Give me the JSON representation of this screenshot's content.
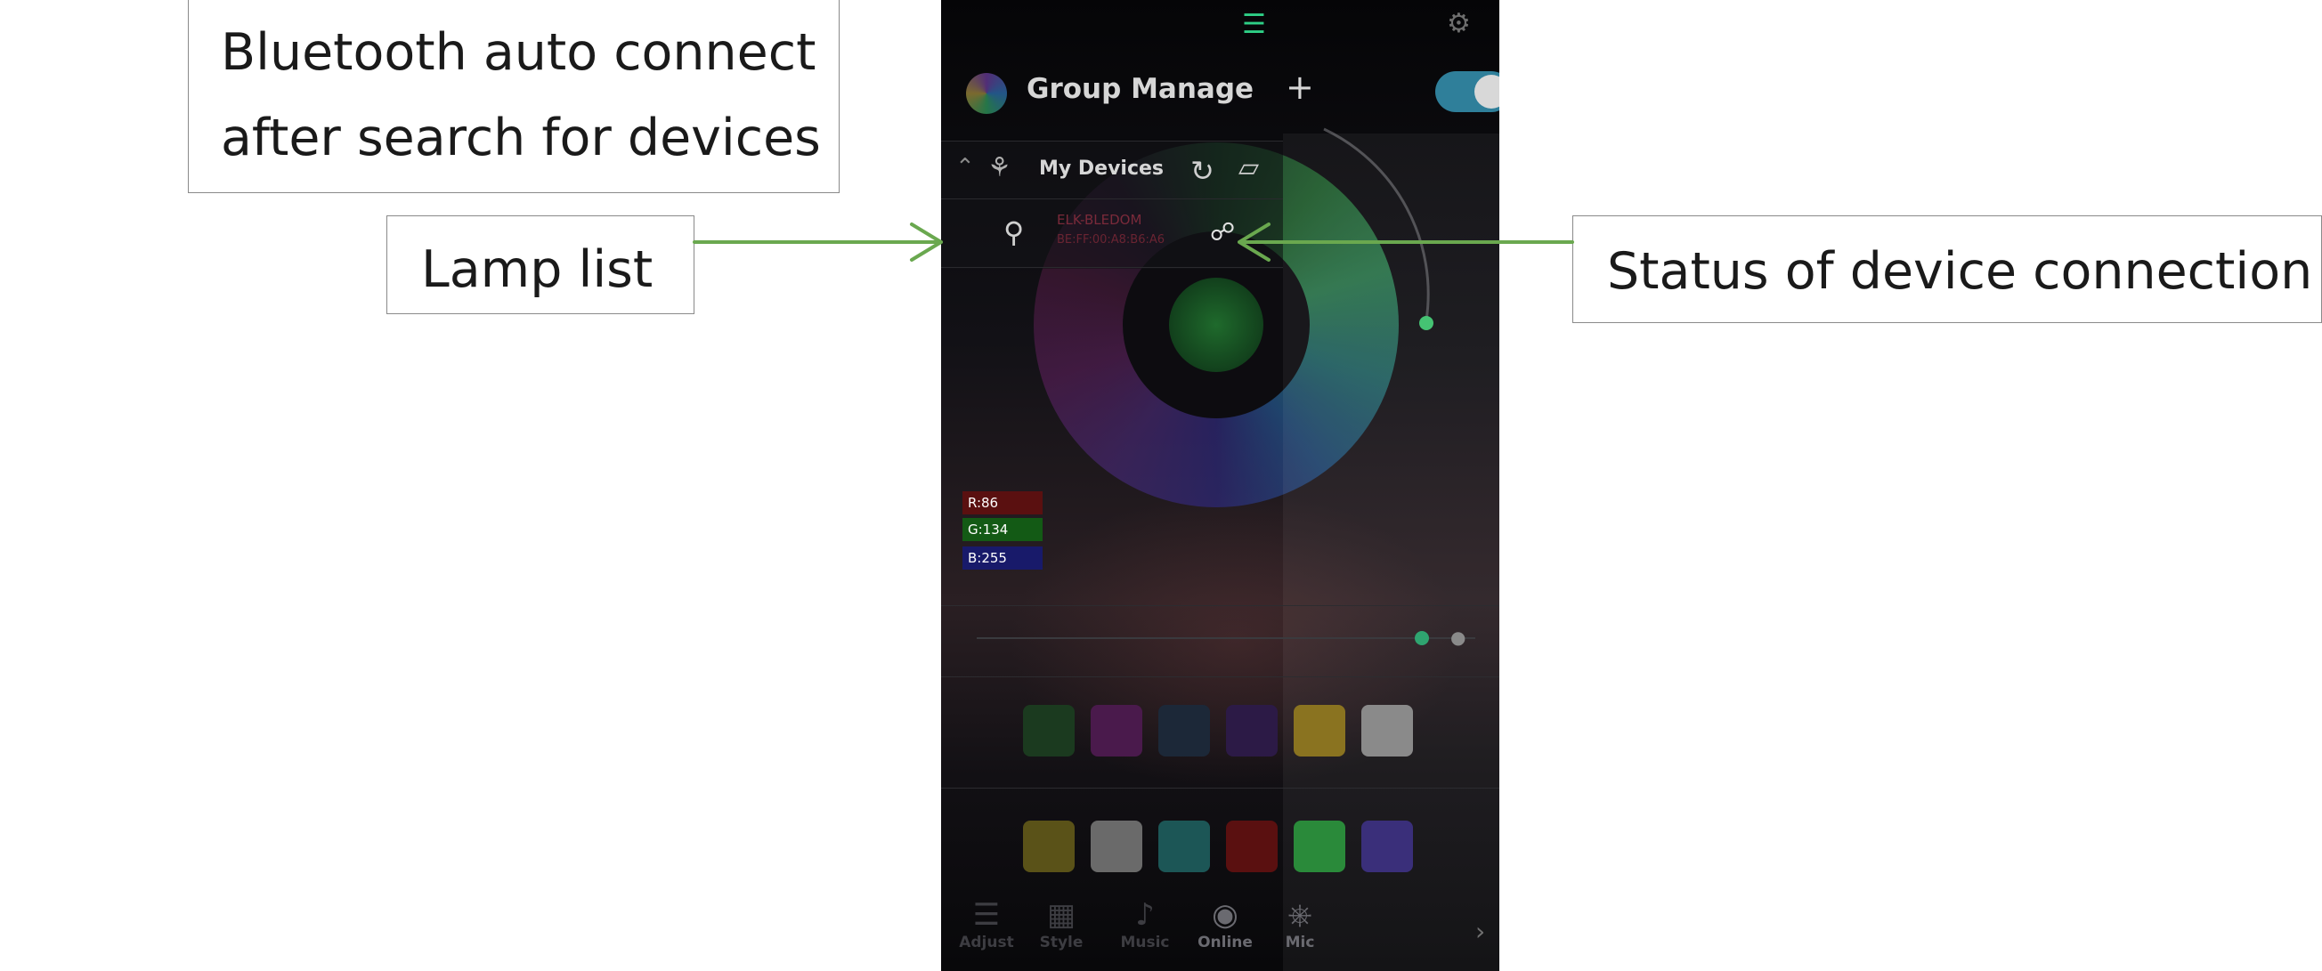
{
  "callouts": {
    "bluetooth": {
      "line1": "Bluetooth auto connect",
      "line2": "after search for devices"
    },
    "lamp_list": "Lamp list",
    "status": "Status of device connection"
  },
  "colors": {
    "arrow": "#6aa84f",
    "accent": "#2ecf86",
    "toggle": "#2f7f9a"
  },
  "phone": {
    "top_bar": {
      "list_icon": "list-icon",
      "settings_icon": "gear-icon"
    },
    "group": {
      "title": "Group Manage",
      "add": "+"
    },
    "toggle": {
      "on": true
    },
    "devices": {
      "title": "My Devices",
      "lamp": {
        "name": "ELK-BLEDOM",
        "mac": "BE:FF:00:A8:B6:A6",
        "status_icon": "link-icon"
      }
    },
    "rgb": {
      "r": "R:86",
      "g": "G:134",
      "b": "B:255"
    },
    "tabs": [
      {
        "label": "Adjust",
        "icon": "sliders-icon"
      },
      {
        "label": "Style",
        "icon": "grid-icon"
      },
      {
        "label": "Music",
        "icon": "music-icon"
      },
      {
        "label": "Online",
        "icon": "online-icon"
      },
      {
        "label": "Mic",
        "icon": "mic-icon"
      }
    ],
    "swatches_row1": [
      "#1b3a1f",
      "#4a1a4c",
      "#1c2838",
      "#2c1a46",
      "#8a7320",
      "#8a8a8a"
    ],
    "swatches_row2": [
      "#5a5218",
      "#6a6a6a",
      "#1c5656",
      "#5a1010",
      "#2a8a3a",
      "#3a2f7a"
    ]
  }
}
